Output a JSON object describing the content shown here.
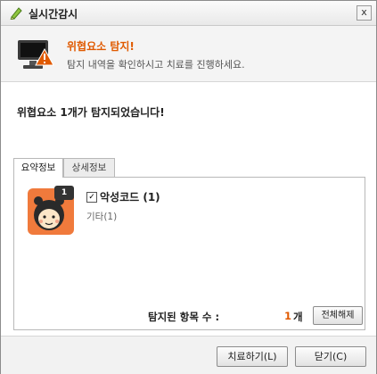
{
  "window": {
    "title": "실시간감시",
    "close_glyph": "x"
  },
  "header": {
    "title": "위협요소 탐지!",
    "subtitle": "탐지 내역을 확인하시고 치료를 진행하세요."
  },
  "message": "위협요소 1개가 탐지되었습니다!",
  "tabs": [
    {
      "label": "요약정보",
      "active": true
    },
    {
      "label": "상세정보",
      "active": false
    }
  ],
  "summary": {
    "badge_count": "1",
    "item": {
      "checked": true,
      "label": "악성코드 (1)",
      "sub": "기타(1)"
    },
    "detected_label": "탐지된 항목 수 :",
    "detected_count": "1",
    "detected_unit": "개",
    "deselect_all": "전체해제"
  },
  "footer": {
    "treat_button": "치료하기(L)",
    "close_button": "닫기(C)"
  },
  "colors": {
    "accent": "#e05a00",
    "avatar_bg": "#f07a3c"
  }
}
